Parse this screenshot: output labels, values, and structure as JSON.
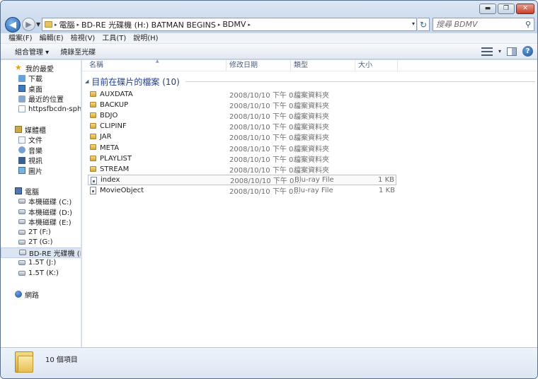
{
  "window": {
    "controls": {
      "minimize": "▬",
      "maximize": "❐",
      "close": "✕"
    }
  },
  "nav": {
    "back": "◀",
    "forward": "▶",
    "history": "▼"
  },
  "address": {
    "crumbs": [
      "電腦",
      "BD-RE 光碟機 (H:) BATMAN BEGINS",
      "BDMV"
    ],
    "separator": "▸",
    "dropdown": "▾",
    "refresh": "↻"
  },
  "search": {
    "placeholder": "搜尋 BDMV",
    "icon": "⚲"
  },
  "menu": [
    "檔案(F)",
    "編輯(E)",
    "檢視(V)",
    "工具(T)",
    "說明(H)"
  ],
  "toolbar": {
    "organize": "組合管理 ▾",
    "burn": "燒錄至光碟",
    "views_drop": "▾",
    "help": "?"
  },
  "navpane": {
    "favorites": {
      "title": "我的最愛",
      "items": [
        "下載",
        "桌面",
        "最近的位置",
        "httpsfbcdn-sphot"
      ]
    },
    "libraries": {
      "title": "媒體櫃",
      "items": [
        "文件",
        "音樂",
        "視訊",
        "圖片"
      ]
    },
    "computer": {
      "title": "電腦",
      "items": [
        "本機磁碟 (C:)",
        "本機磁碟 (D:)",
        "本機磁碟 (E:)",
        "2T (F:)",
        "2T (G:)",
        "BD-RE 光碟機 (H:)",
        "1.5T (J:)",
        "1.5T (K:)"
      ],
      "selected_index": 5
    },
    "network": {
      "title": "網路"
    }
  },
  "columns": {
    "name": "名稱",
    "date": "修改日期",
    "type": "類型",
    "size": "大小",
    "sort_caret": "▲"
  },
  "group": {
    "title": "目前在碟片的檔案 (10)",
    "chevron": "◢"
  },
  "files": [
    {
      "name": "AUXDATA",
      "date": "2008/10/10 下午 0...",
      "type": "檔案資料夾",
      "size": "",
      "kind": "folder"
    },
    {
      "name": "BACKUP",
      "date": "2008/10/10 下午 0...",
      "type": "檔案資料夾",
      "size": "",
      "kind": "folder"
    },
    {
      "name": "BDJO",
      "date": "2008/10/10 下午 0...",
      "type": "檔案資料夾",
      "size": "",
      "kind": "folder"
    },
    {
      "name": "CLIPINF",
      "date": "2008/10/10 下午 0...",
      "type": "檔案資料夾",
      "size": "",
      "kind": "folder"
    },
    {
      "name": "JAR",
      "date": "2008/10/10 下午 0...",
      "type": "檔案資料夾",
      "size": "",
      "kind": "folder"
    },
    {
      "name": "META",
      "date": "2008/10/10 下午 0...",
      "type": "檔案資料夾",
      "size": "",
      "kind": "folder"
    },
    {
      "name": "PLAYLIST",
      "date": "2008/10/10 下午 0...",
      "type": "檔案資料夾",
      "size": "",
      "kind": "folder"
    },
    {
      "name": "STREAM",
      "date": "2008/10/10 下午 0...",
      "type": "檔案資料夾",
      "size": "",
      "kind": "folder"
    },
    {
      "name": "index",
      "date": "2008/10/10 下午 0...",
      "type": "Blu-ray File",
      "size": "1 KB",
      "kind": "file"
    },
    {
      "name": "MovieObject",
      "date": "2008/10/10 下午 0...",
      "type": "Blu-ray File",
      "size": "1 KB",
      "kind": "file"
    }
  ],
  "selected_file_index": 8,
  "details": {
    "item_count": "10 個項目"
  },
  "colors": {
    "accent": "#1e3d8f",
    "chrome": "#cfdced",
    "selection": "#dce6f3"
  }
}
